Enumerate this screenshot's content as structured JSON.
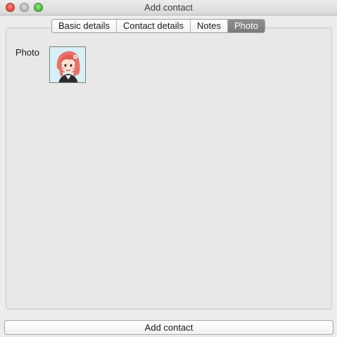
{
  "window": {
    "title": "Add contact",
    "controls": [
      "close-icon",
      "minimize-icon",
      "zoom-icon"
    ]
  },
  "tabs": [
    {
      "label": "Basic details",
      "active": false
    },
    {
      "label": "Contact details",
      "active": false
    },
    {
      "label": "Notes",
      "active": false
    },
    {
      "label": "Photo",
      "active": true
    }
  ],
  "photo_section": {
    "label": "Photo",
    "avatar_icon": "avatar-photo"
  },
  "footer": {
    "add_button_label": "Add contact"
  },
  "colors": {
    "active_tab_bg": "#838383",
    "close": "#e0443a",
    "minimize": "#b5b5b5",
    "zoom": "#48b43a",
    "avatar_hair": "#e8726a",
    "avatar_bg": "#d8f0f7"
  }
}
